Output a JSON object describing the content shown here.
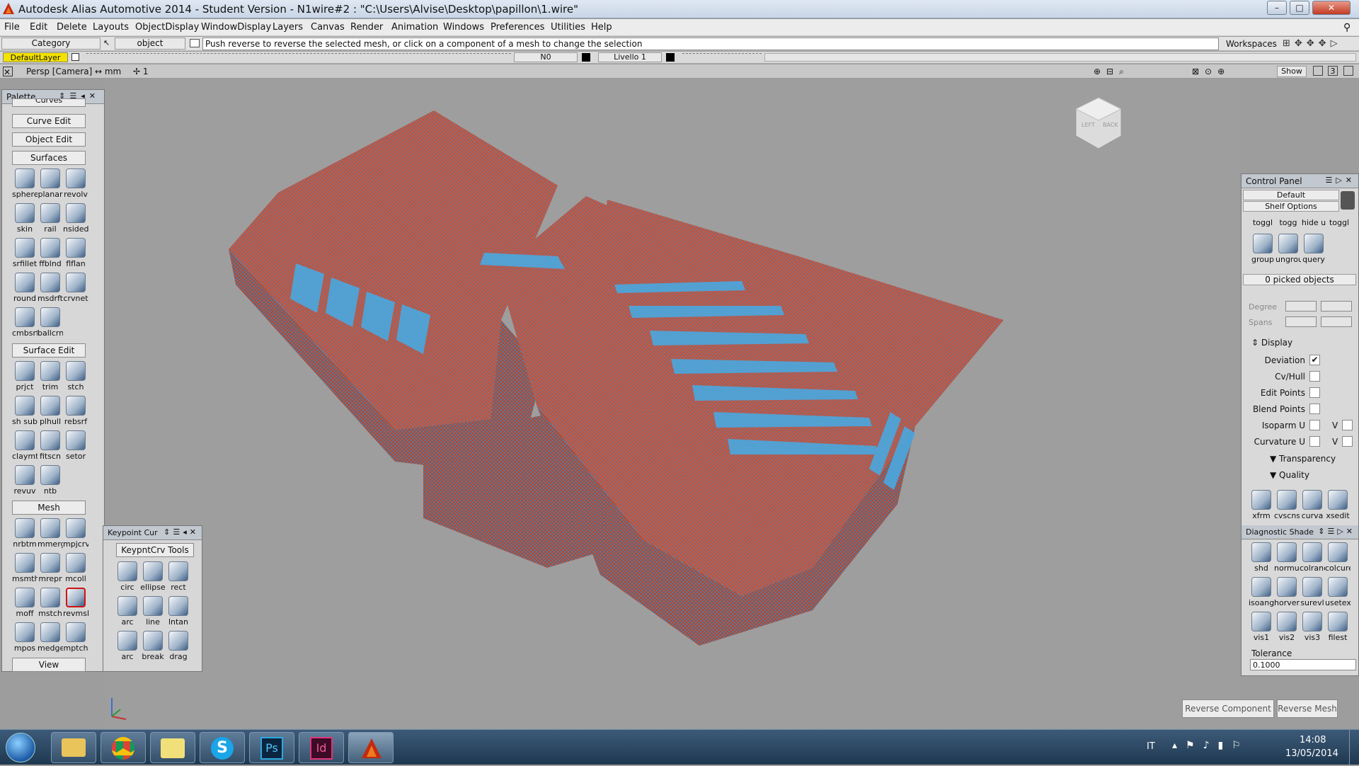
{
  "window": {
    "title": "Autodesk Alias Automotive 2014   - Student Version   - N1wire#2 : \"C:\\Users\\Alvise\\Desktop\\papillon\\1.wire\""
  },
  "menu": [
    "File",
    "Edit",
    "Delete",
    "Layouts",
    "ObjectDisplay",
    "WindowDisplay",
    "Layers",
    "Canvas",
    "Render",
    "Animation",
    "Windows",
    "Preferences",
    "Utilities",
    "Help"
  ],
  "prompt": {
    "category": "Category",
    "object": "object",
    "message": "Push reverse to reverse the selected mesh, or click on a component of a mesh to change the selection",
    "workspaces": "Workspaces"
  },
  "layers": {
    "default": "DefaultLayer",
    "n0": "N0",
    "livello": "Livello 1"
  },
  "view": {
    "camera": "Persp [Camera]",
    "units": "↔ mm",
    "snap": "✢ 1",
    "show": "Show",
    "num": "3"
  },
  "palette": {
    "title": "Palette",
    "curves_cut": "Curves",
    "curve_edit": "Curve Edit",
    "object_edit": "Object Edit",
    "surfaces": "Surfaces",
    "surfaces_tools": [
      "sphere",
      "planar",
      "revolv",
      "skin",
      "rail",
      "nsided",
      "srfillet",
      "ffblnd",
      "flflan",
      "round",
      "msdrft",
      "crvnet",
      "cmbsrf",
      "ballcrn"
    ],
    "surface_edit": "Surface Edit",
    "surface_edit_tools": [
      "prjct",
      "trim",
      "stch",
      "sh sub",
      "plhull",
      "rebsrf",
      "claymt",
      "fitscn",
      "setor",
      "revuv",
      "ntb"
    ],
    "mesh": "Mesh",
    "mesh_tools": [
      "nrbtm",
      "mmerg",
      "mpjcrv",
      "msmth",
      "mrepr",
      "mcoll",
      "moff",
      "mstch",
      "revmsh",
      "mpos",
      "medge",
      "mptch"
    ],
    "view": "View"
  },
  "keypoint": {
    "title": "Keypoint Cur",
    "tab": "KeypntCrv Tools",
    "tools": [
      "circ",
      "ellipse",
      "rect",
      "arc",
      "line",
      "lntan",
      "arc",
      "break",
      "drag"
    ]
  },
  "control": {
    "title": "Control Panel",
    "default": "Default",
    "shelf": "Shelf Options",
    "shelf_tools": [
      "toggl",
      "togg",
      "hide u",
      "toggl",
      "group",
      "ungrou",
      "query"
    ],
    "picked": "0 picked objects",
    "degree": "Degree",
    "spans": "Spans",
    "display": "Display",
    "rows": [
      {
        "label": "Deviation",
        "checked": "✔"
      },
      {
        "label": "Cv/Hull",
        "checked": ""
      },
      {
        "label": "Edit Points",
        "checked": ""
      },
      {
        "label": "Blend Points",
        "checked": ""
      },
      {
        "label": "Isoparm U",
        "checked": ""
      },
      {
        "label": "Curvature U",
        "checked": ""
      }
    ],
    "v": "V",
    "transparency": "Transparency",
    "quality": "Quality",
    "curvature_tools": [
      "xfrm",
      "cvscnsrf",
      "curva",
      "xsedit"
    ],
    "diag_title": "Diagnostic Shade",
    "diag_tools": [
      "shd",
      "normul",
      "colranc",
      "colcurevl",
      "isoang",
      "horver",
      "surevl",
      "usetex",
      "vis1",
      "vis2",
      "vis3",
      "filest"
    ],
    "tolerance": "Tolerance",
    "tolerance_value": "0.1000"
  },
  "buttons": {
    "reverse_component": "Reverse Component",
    "reverse_mesh": "Reverse Mesh"
  },
  "viewcube": {
    "left": "LEFT",
    "back": "BACK"
  },
  "taskbar": {
    "lang": "IT",
    "time": "14:08",
    "date": "13/05/2014"
  }
}
